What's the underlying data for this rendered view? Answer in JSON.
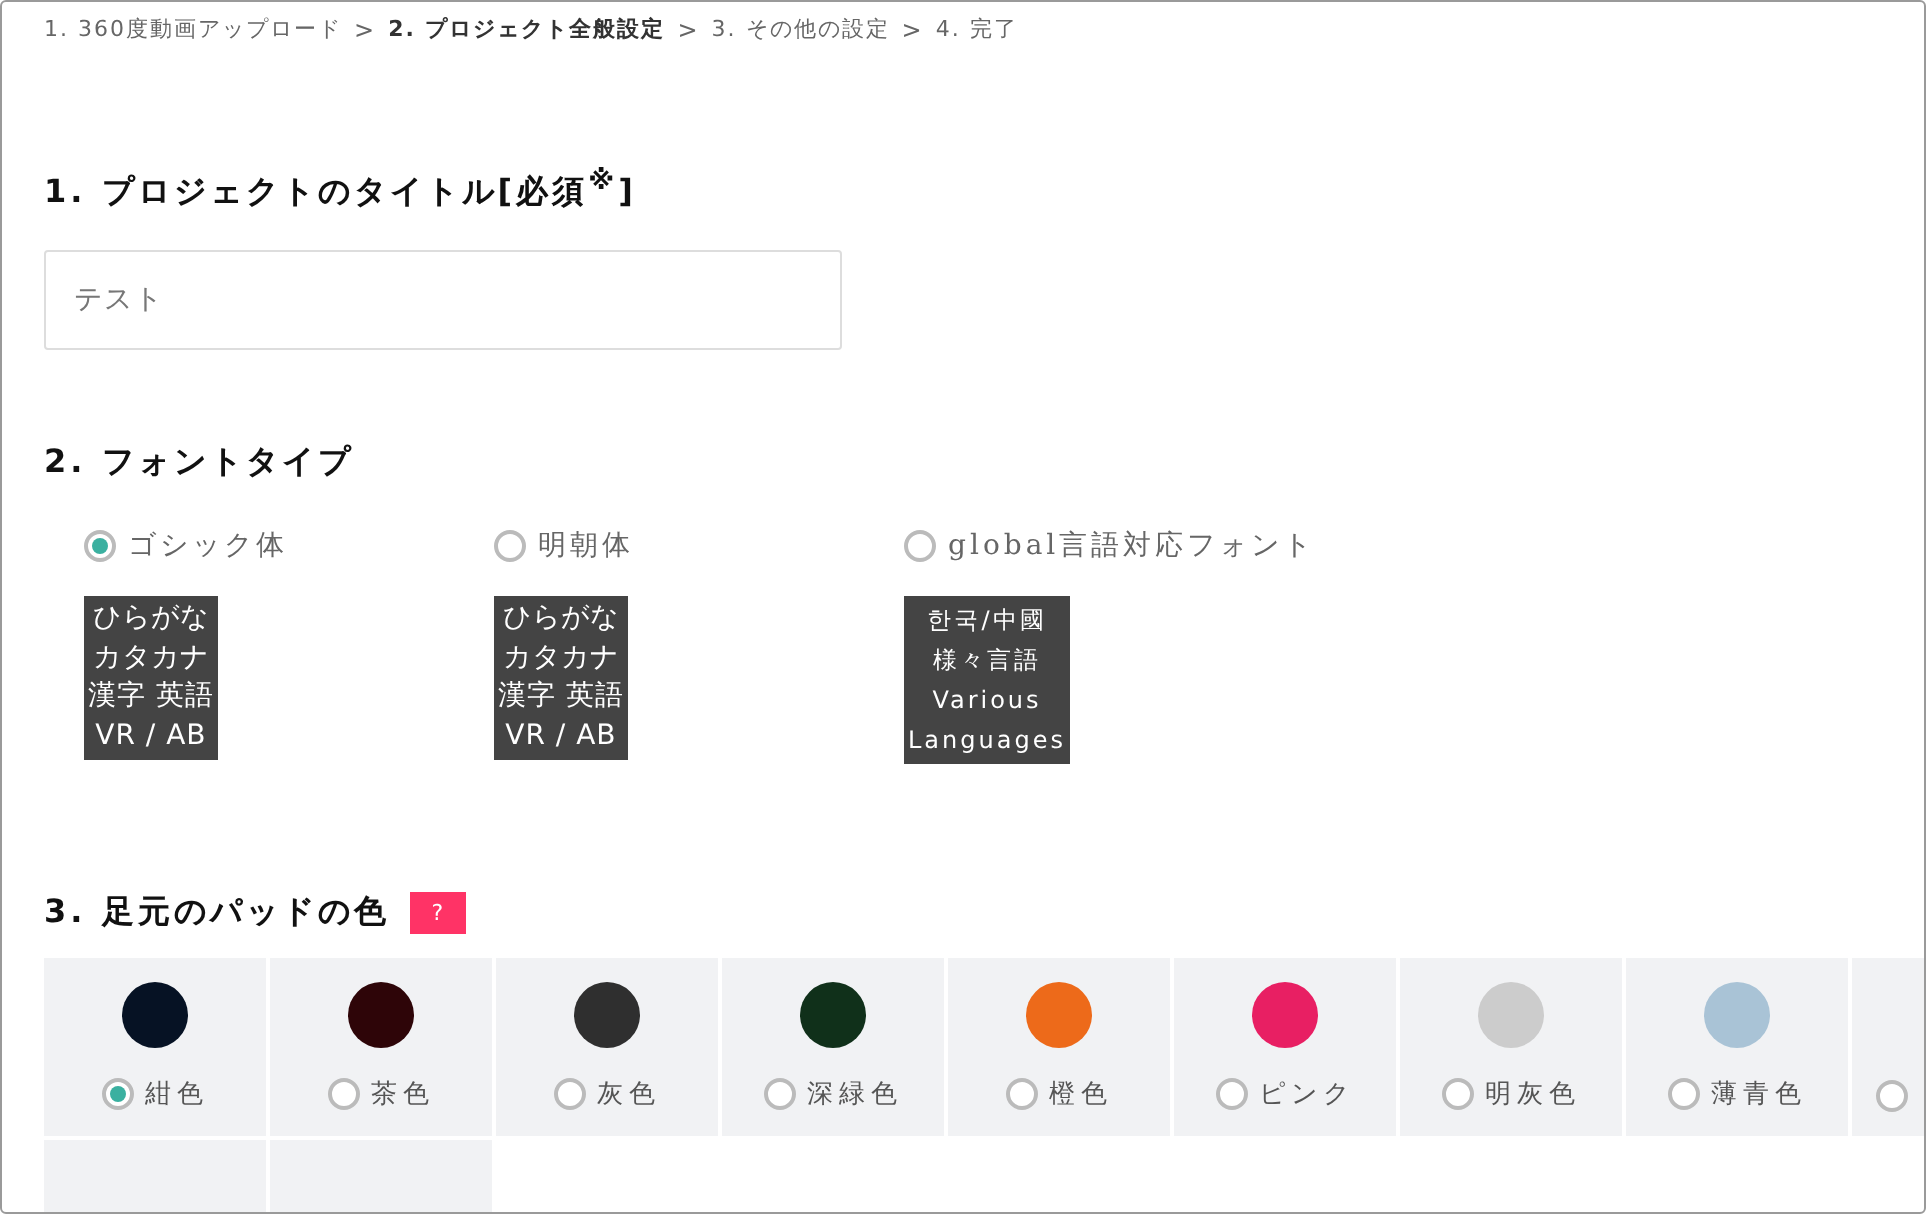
{
  "breadcrumb": [
    {
      "label": "1. 360度動画アップロード",
      "selected": false
    },
    {
      "label": "2. プロジェクト全般設定",
      "selected": true
    },
    {
      "label": "3. その他の設定",
      "selected": false
    },
    {
      "label": "4. 完了",
      "selected": false
    }
  ],
  "breadcrumb_separator": ">",
  "title_section": {
    "heading": "1. プロジェクトのタイトル[必須$^{※}$]",
    "value": "テスト"
  },
  "font_section": {
    "heading": "2. フォントタイプ",
    "options": [
      {
        "label": "ゴシック体",
        "selected": true,
        "sample": [
          "ひらがな",
          "カタカナ",
          "漢字 英語",
          "VR / AB"
        ]
      },
      {
        "label": "明朝体",
        "selected": false,
        "sample": [
          "ひらがな",
          "カタカナ",
          "漢字 英語",
          "VR / AB"
        ]
      },
      {
        "label": "global言語対応フォント",
        "selected": false,
        "sample": [
          "한국/中國",
          "様々言語",
          "Various",
          "Languages"
        ]
      }
    ]
  },
  "color_section": {
    "heading": "3. 足元のパッドの色",
    "help": "?",
    "colors": [
      {
        "label": "紺色",
        "color": "#061224",
        "selected": true
      },
      {
        "label": "茶色",
        "color": "#2e0508",
        "selected": false
      },
      {
        "label": "灰色",
        "color": "#2f2f2f",
        "selected": false
      },
      {
        "label": "深緑色",
        "color": "#10301a",
        "selected": false
      },
      {
        "label": "橙色",
        "color": "#ed6a1a",
        "selected": false
      },
      {
        "label": "ピンク",
        "color": "#e81f63",
        "selected": false
      },
      {
        "label": "明灰色",
        "color": "#cccccc",
        "selected": false
      },
      {
        "label": "薄青色",
        "color": "#a9c3d6",
        "selected": false
      },
      {
        "selected": false
      }
    ]
  }
}
